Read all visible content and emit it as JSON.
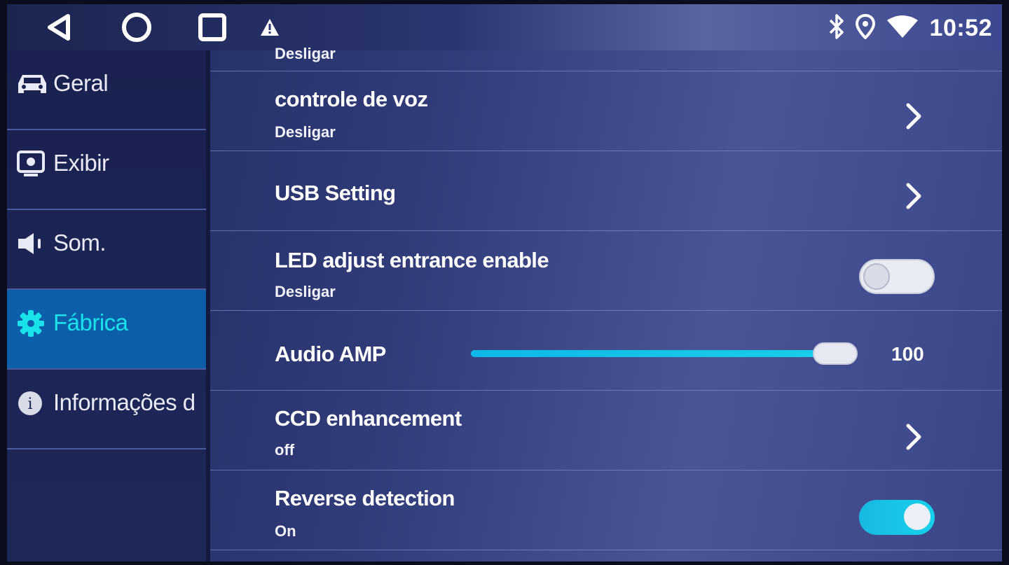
{
  "status_bar": {
    "nav_icons": [
      "back-icon",
      "home-icon",
      "recent-apps-icon"
    ],
    "notification_icon": "warning-icon",
    "status_icons": [
      "bluetooth-icon",
      "location-icon",
      "wifi-icon"
    ],
    "time": "10:52"
  },
  "sidebar": {
    "items": [
      {
        "label": "Geral",
        "icon": "car-icon",
        "active": false
      },
      {
        "label": "Exibir",
        "icon": "display-icon",
        "active": false
      },
      {
        "label": "Som.",
        "icon": "speaker-icon",
        "active": false
      },
      {
        "label": "Fábrica",
        "icon": "gear-icon",
        "active": true
      },
      {
        "label": "Informações d",
        "icon": "info-icon",
        "active": false
      }
    ]
  },
  "settings": {
    "partial_top_subtitle": "Desligar",
    "rows": [
      {
        "title": "controle de voz",
        "subtitle": "Desligar",
        "control": "chevron"
      },
      {
        "title": "USB Setting",
        "subtitle": "",
        "control": "chevron"
      },
      {
        "title": "LED adjust entrance enable",
        "subtitle": "Desligar",
        "control": "toggle",
        "enabled": false
      },
      {
        "title": "Audio AMP",
        "subtitle": "",
        "control": "slider",
        "value": "100",
        "fraction": 1.0
      },
      {
        "title": "CCD enhancement",
        "subtitle": "off",
        "control": "chevron"
      },
      {
        "title": "Reverse detection",
        "subtitle": "On",
        "control": "toggle",
        "enabled": true
      }
    ]
  },
  "colors": {
    "accent": "#19e2ea",
    "active_sidebar_bg": "#0d5ea8",
    "toggle_on": "#18b8e0"
  }
}
